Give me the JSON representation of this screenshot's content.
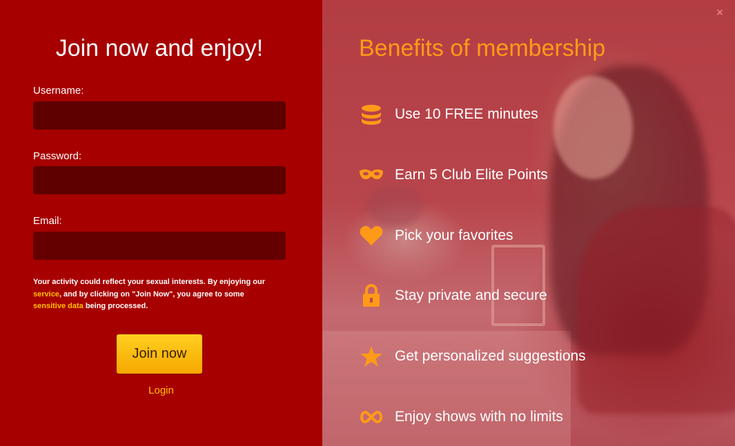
{
  "form": {
    "title": "Join now and enjoy!",
    "username_label": "Username:",
    "username_value": "",
    "password_label": "Password:",
    "password_value": "",
    "email_label": "Email:",
    "email_value": "",
    "disclaimer": {
      "part1": "Your activity could reflect your sexual interests. By enjoying our ",
      "link_service": "service",
      "part2": ", and by clicking on \"Join Now\", you agree to some ",
      "link_sensitive": "sensitive data",
      "part3": " being processed."
    },
    "join_button": "Join now",
    "login_link": "Login"
  },
  "benefits": {
    "title": "Benefits of membership",
    "close_label": "×",
    "items": [
      {
        "icon": "coins-stack-icon",
        "label": "Use 10 FREE minutes"
      },
      {
        "icon": "mask-icon",
        "label": "Earn 5 Club Elite Points"
      },
      {
        "icon": "heart-icon",
        "label": "Pick your favorites"
      },
      {
        "icon": "lock-icon",
        "label": "Stay private and secure"
      },
      {
        "icon": "star-icon",
        "label": "Get personalized suggestions"
      },
      {
        "icon": "infinity-icon",
        "label": "Enjoy shows with no limits"
      }
    ]
  },
  "colors": {
    "left_background": "#a70000",
    "input_background": "#5e0000",
    "accent_orange": "#ff9a18",
    "link_yellow": "#ffc000",
    "button_yellow": "#ffcf21"
  }
}
